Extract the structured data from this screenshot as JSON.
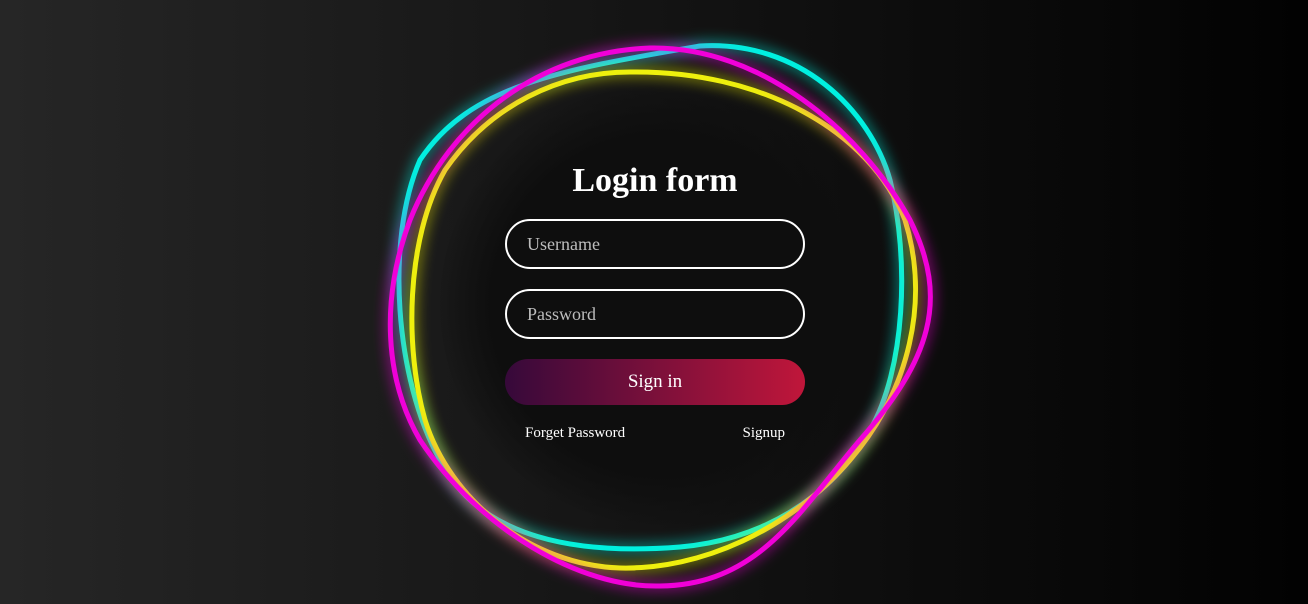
{
  "form": {
    "title": "Login form",
    "username_placeholder": "Username",
    "password_placeholder": "Password",
    "signin_label": "Sign in",
    "forget_label": "Forget Password",
    "signup_label": "Signup"
  },
  "theme": {
    "ring_colors": [
      "#00f0e0",
      "#eef010",
      "#f000d8"
    ],
    "button_gradient": [
      "#36093a",
      "#c0163a"
    ]
  }
}
